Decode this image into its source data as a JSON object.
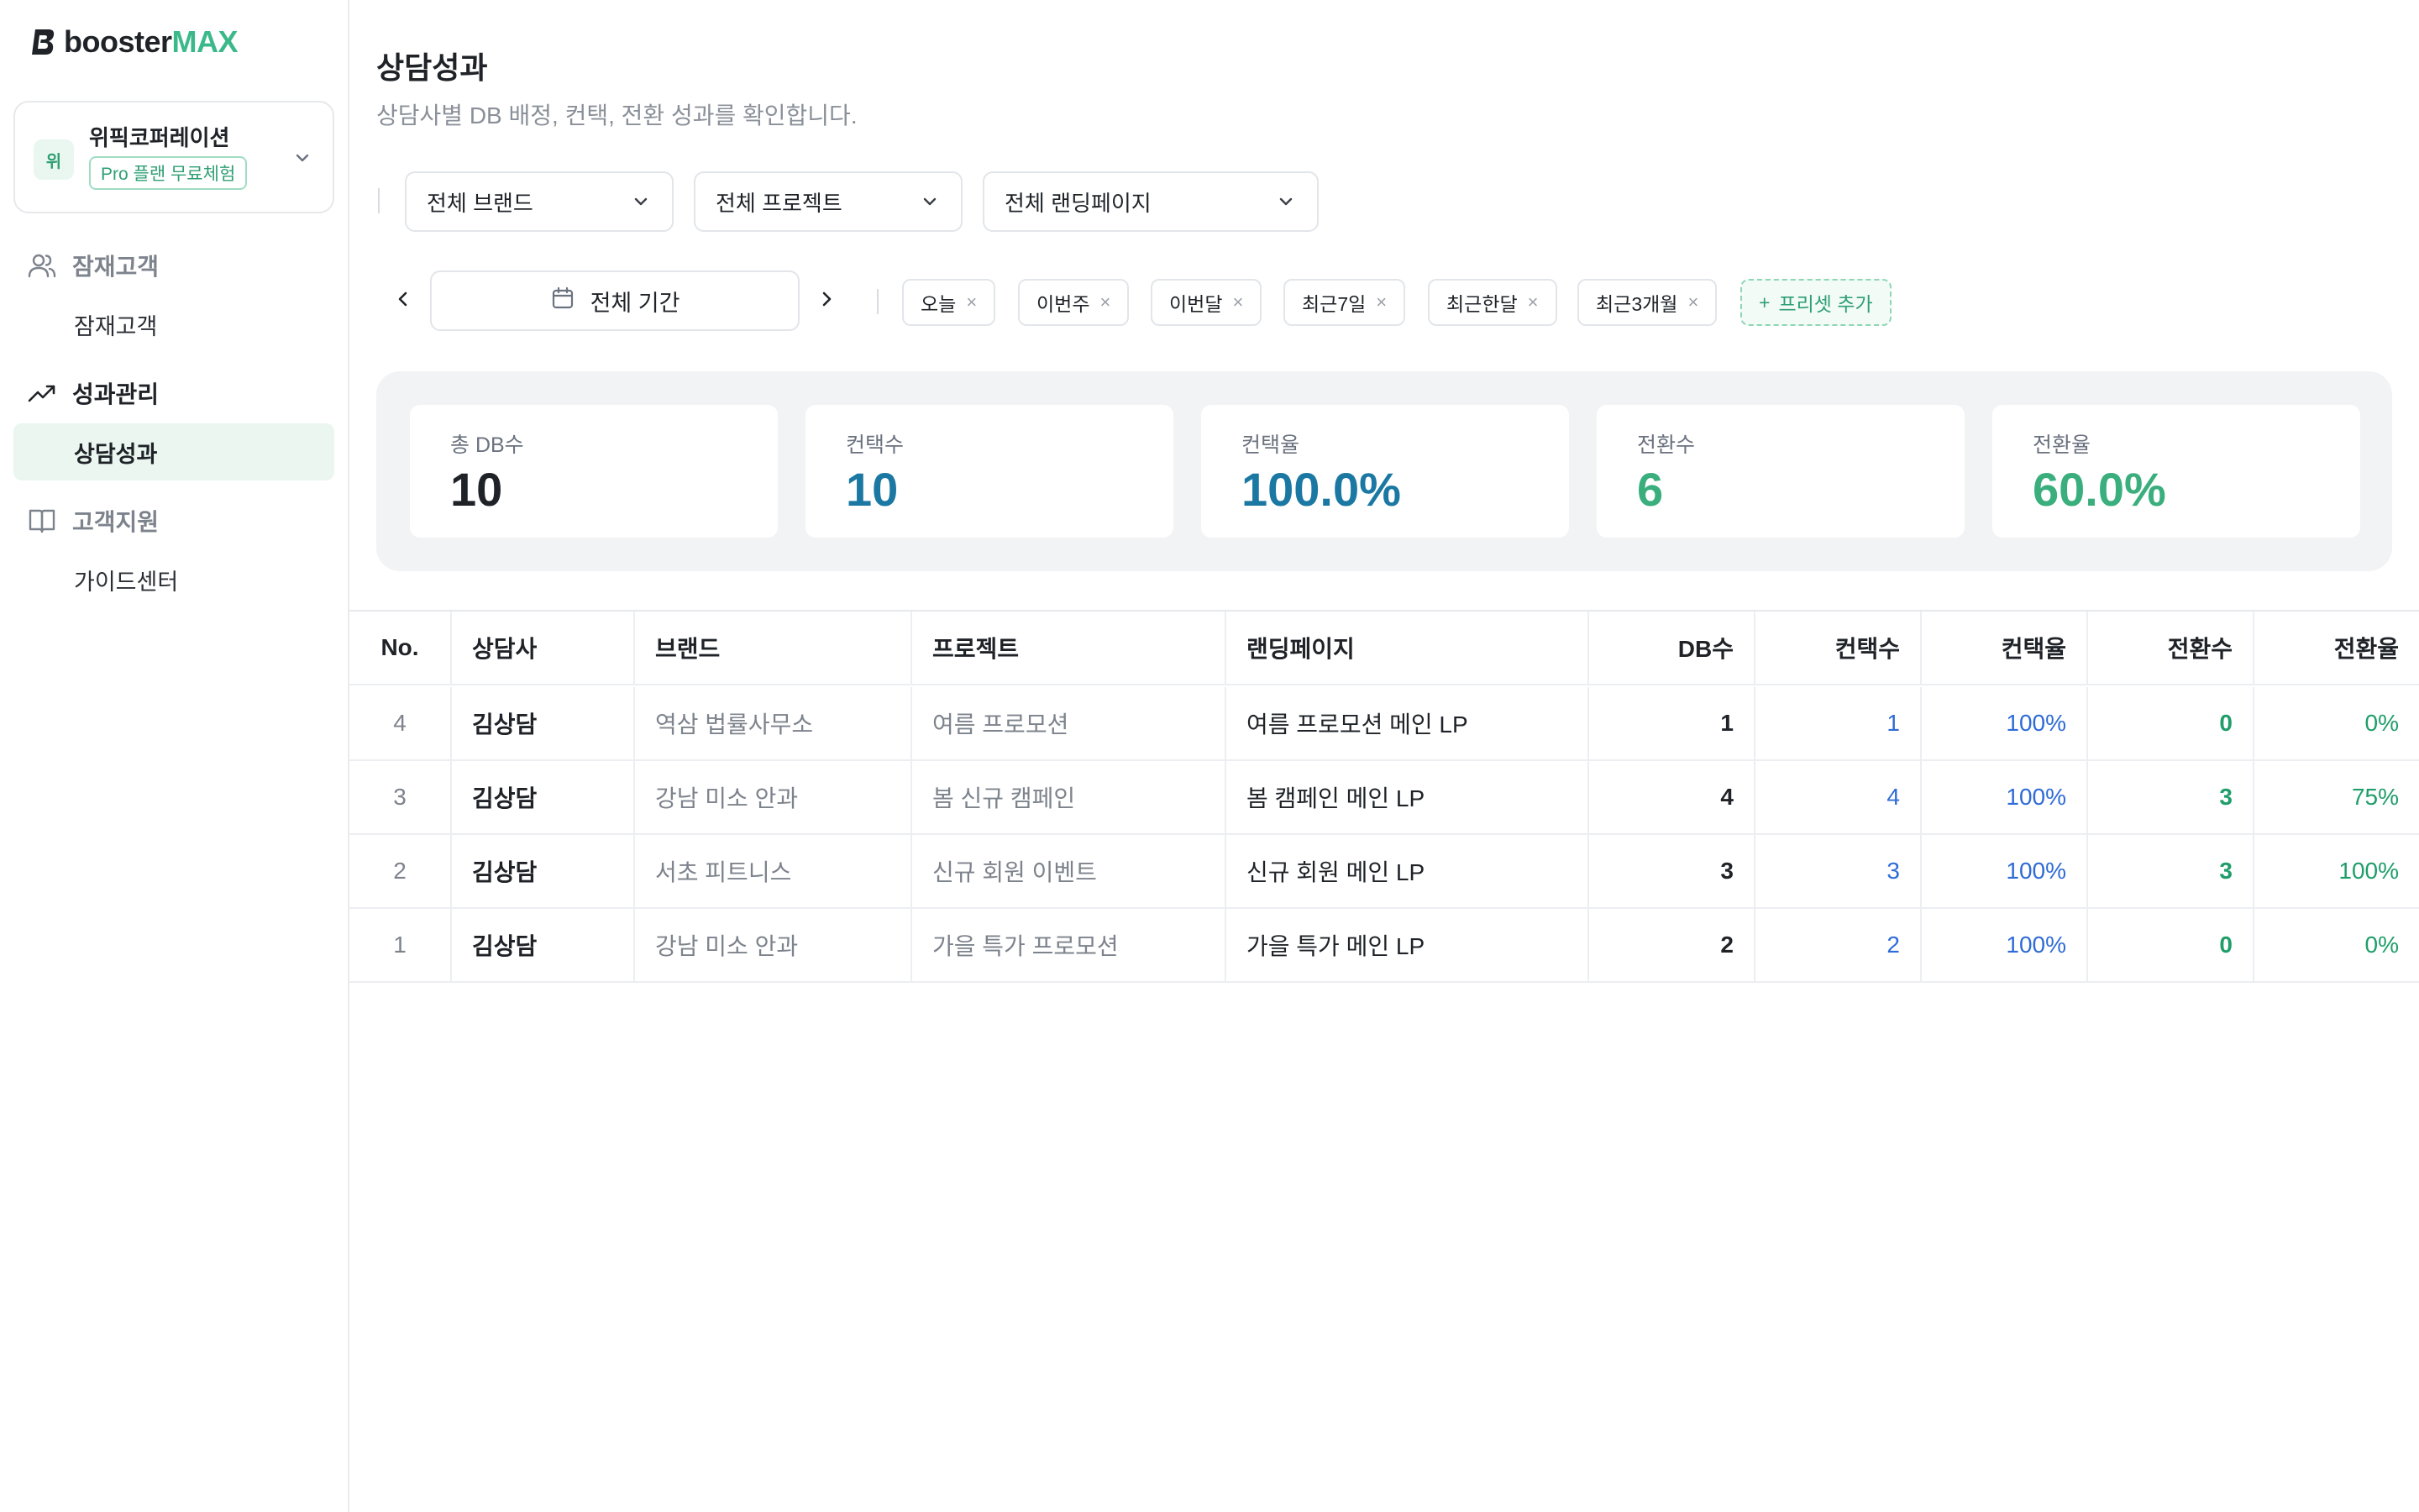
{
  "brand": {
    "name_part1": "booster",
    "name_part2": "MAX"
  },
  "workspace": {
    "avatar": "위",
    "name": "위픽코퍼레이션",
    "badge": "Pro 플랜 무료체험"
  },
  "nav": {
    "group1": {
      "label": "잠재고객",
      "icon": "users-icon",
      "sub": "잠재고객"
    },
    "group2": {
      "label": "성과관리",
      "icon": "trend-icon",
      "sub": "상담성과"
    },
    "group3": {
      "label": "고객지원",
      "icon": "book-icon",
      "sub": "가이드센터"
    }
  },
  "page": {
    "title": "상담성과",
    "subtitle": "상담사별 DB 배정, 컨택, 전환 성과를 확인합니다."
  },
  "filters": {
    "brand": "전체 브랜드",
    "project": "전체 프로젝트",
    "landing": "전체 랜딩페이지"
  },
  "period": {
    "label": "전체 기간",
    "presets": [
      "오늘",
      "이번주",
      "이번달",
      "최근7일",
      "최근한달",
      "최근3개월"
    ],
    "add_preset": "프리셋 추가"
  },
  "kpis": [
    {
      "label": "총 DB수",
      "value": "10",
      "color": "#1f2328"
    },
    {
      "label": "컨택수",
      "value": "10",
      "color": "#1b78a3"
    },
    {
      "label": "컨택율",
      "value": "100.0%",
      "color": "#1b78a3"
    },
    {
      "label": "전환수",
      "value": "6",
      "color": "#3aae7c"
    },
    {
      "label": "전환율",
      "value": "60.0%",
      "color": "#3aae7c"
    }
  ],
  "table": {
    "headers": [
      "No.",
      "상담사",
      "브랜드",
      "프로젝트",
      "랜딩페이지",
      "DB수",
      "컨택수",
      "컨택율",
      "전환수",
      "전환율"
    ],
    "rows": [
      [
        "4",
        "김상담",
        "역삼 법률사무소",
        "여름 프로모션",
        "여름 프로모션 메인 LP",
        "1",
        "1",
        "100%",
        "0",
        "0%"
      ],
      [
        "3",
        "김상담",
        "강남 미소 안과",
        "봄 신규 캠페인",
        "봄 캠페인 메인 LP",
        "4",
        "4",
        "100%",
        "3",
        "75%"
      ],
      [
        "2",
        "김상담",
        "서초 피트니스",
        "신규 회원 이벤트",
        "신규 회원 메인 LP",
        "3",
        "3",
        "100%",
        "3",
        "100%"
      ],
      [
        "1",
        "김상담",
        "강남 미소 안과",
        "가을 특가 프로모션",
        "가을 특가 메인 LP",
        "2",
        "2",
        "100%",
        "0",
        "0%"
      ]
    ]
  }
}
